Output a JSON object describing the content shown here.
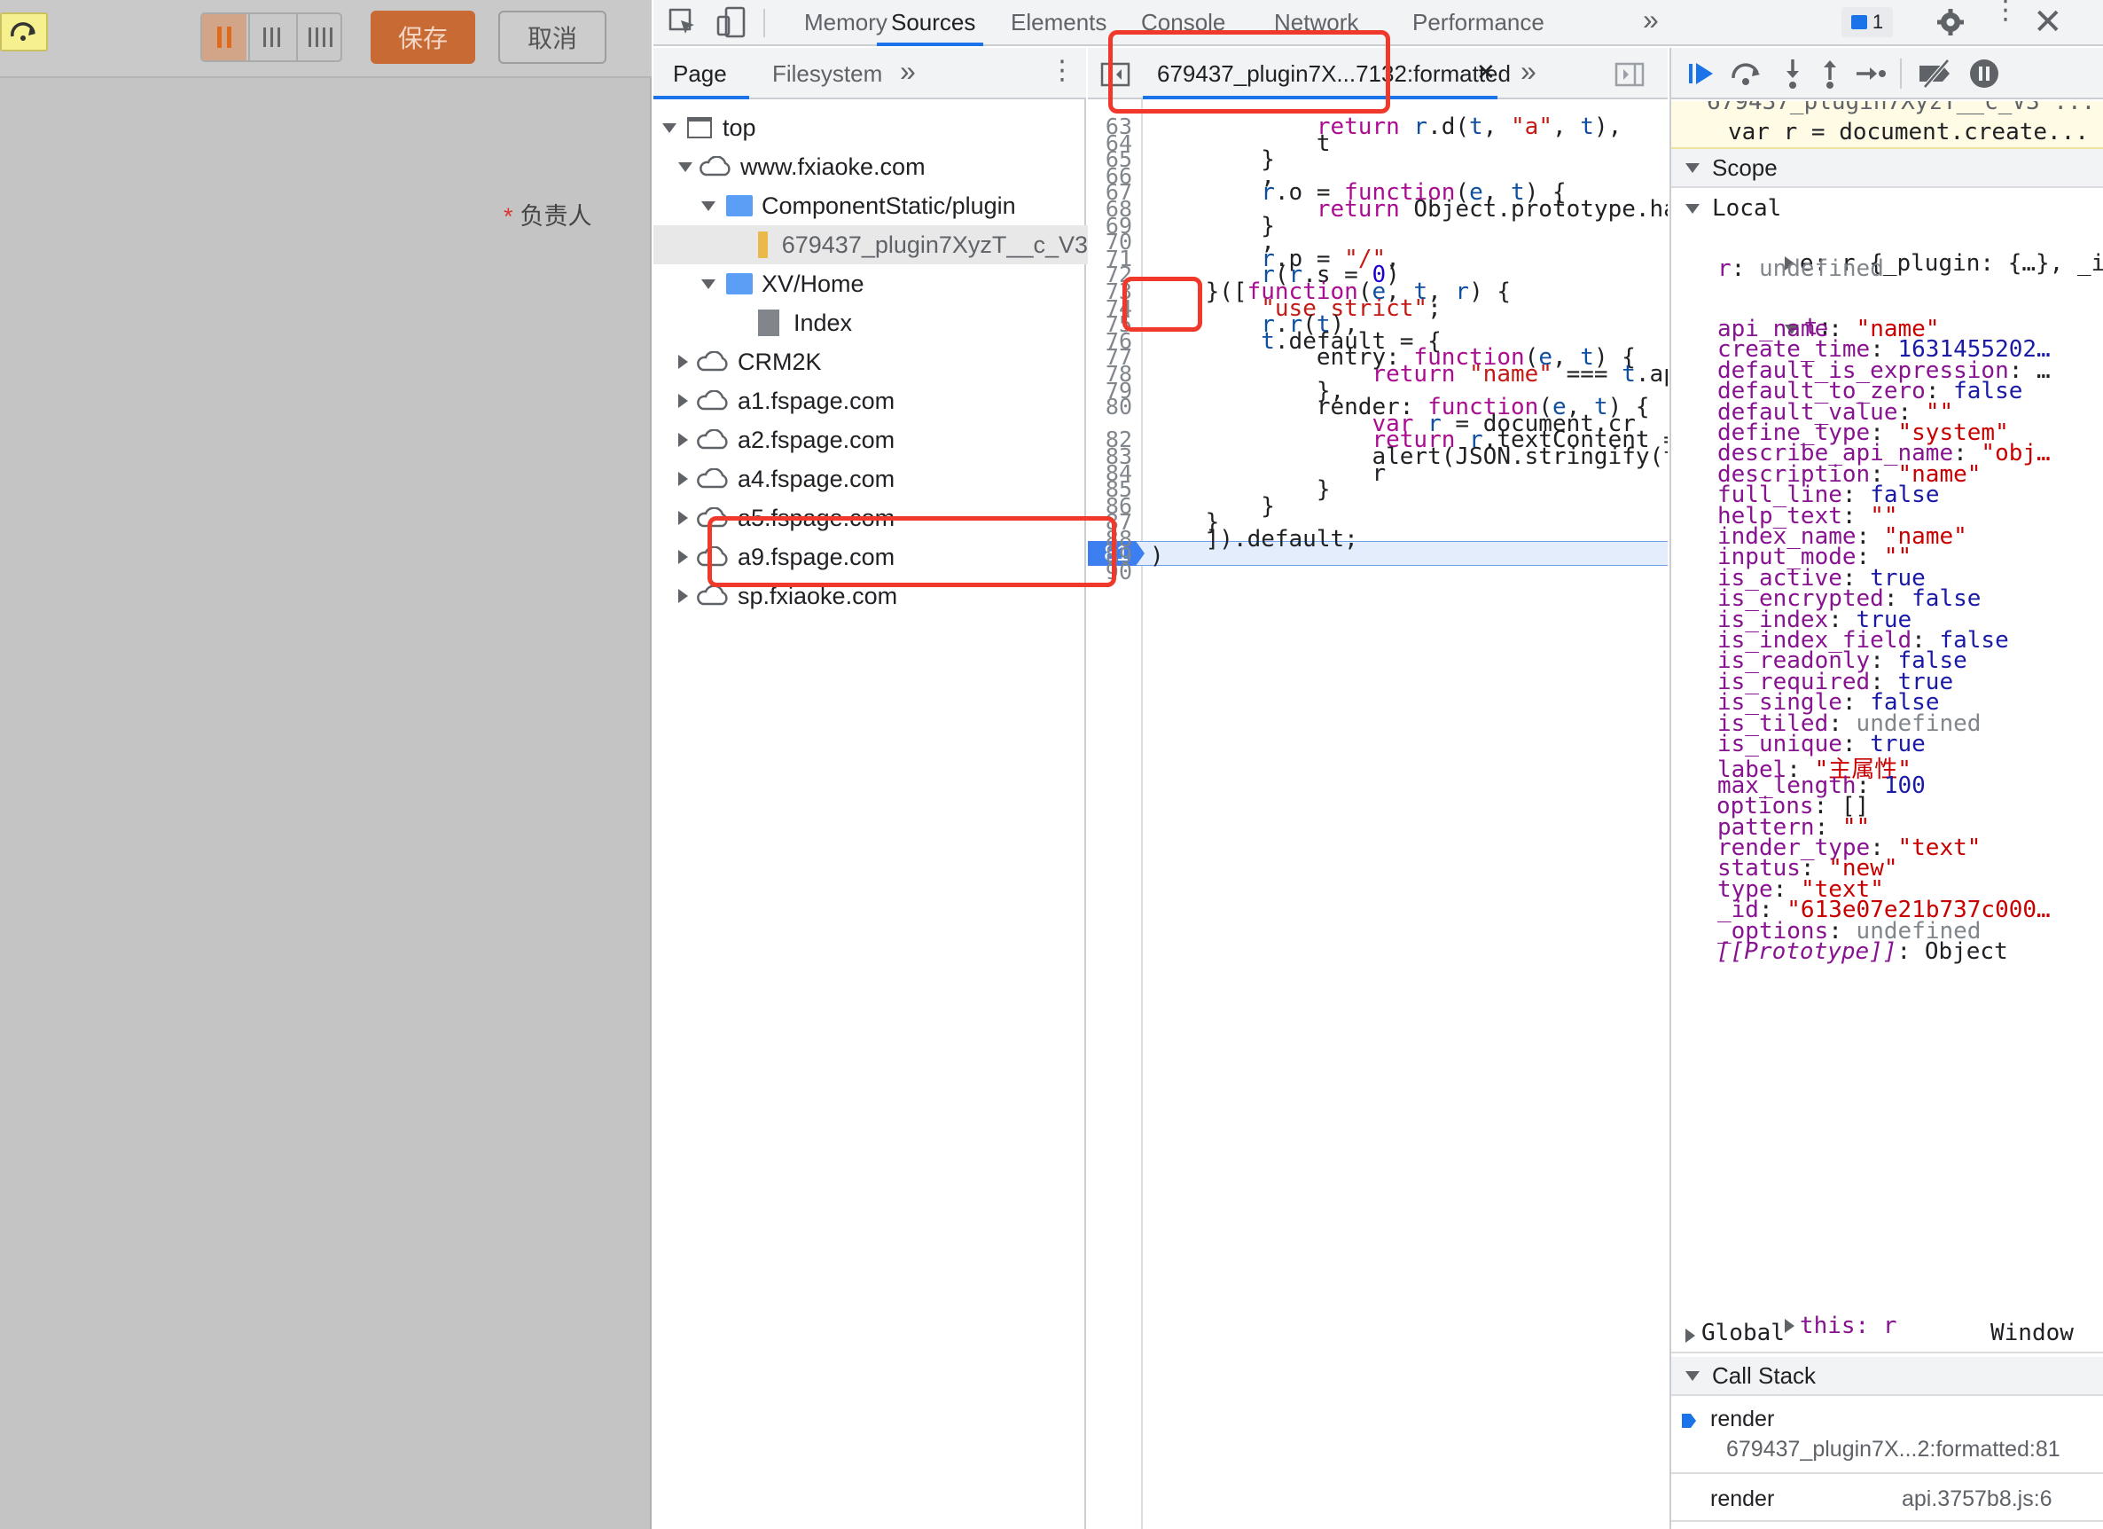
{
  "app": {
    "save_label": "保存",
    "cancel_label": "取消",
    "field_label": "负责人",
    "required_mark": "*"
  },
  "devtools": {
    "main_tabs": [
      "Memory",
      "Sources",
      "Elements",
      "Console",
      "Network",
      "Performance"
    ],
    "active_main_tab": "Sources",
    "message_count": "1",
    "navigator_tabs": [
      "Page",
      "Filesystem"
    ],
    "tree": [
      {
        "label": "top"
      },
      {
        "label": "www.fxiaoke.com"
      },
      {
        "label": "ComponentStatic/plugin"
      },
      {
        "label": "679437_plugin7XyzT__c_V3"
      },
      {
        "label": "XV/Home"
      },
      {
        "label": "Index"
      },
      {
        "label": "CRM2K"
      },
      {
        "label": "a1.fspage.com"
      },
      {
        "label": "a2.fspage.com"
      },
      {
        "label": "a4.fspage.com"
      },
      {
        "label": "a5.fspage.com"
      },
      {
        "label": "a9.fspage.com"
      },
      {
        "label": "sp.fxiaoke.com"
      }
    ],
    "editor_tab": "679437_plugin7X...7132:formatted",
    "breakpoint_line": "81",
    "code_lines": [
      {
        "n": "63",
        "t": "            return r.d(t, \"a\", t),"
      },
      {
        "n": "64",
        "t": "            t"
      },
      {
        "n": "65",
        "t": "        }"
      },
      {
        "n": "66",
        "t": "        ,"
      },
      {
        "n": "67",
        "t": "        r.o = function(e, t) {"
      },
      {
        "n": "68",
        "t": "            return Object.prototype.ha"
      },
      {
        "n": "69",
        "t": "        }"
      },
      {
        "n": "70",
        "t": "        ,"
      },
      {
        "n": "71",
        "t": "        r.p = \"/\","
      },
      {
        "n": "72",
        "t": "        r(r.s = 0)"
      },
      {
        "n": "73",
        "t": "    }([function(e, t, r) {"
      },
      {
        "n": "74",
        "t": "        \"use strict\";"
      },
      {
        "n": "75",
        "t": "        r.r(t),"
      },
      {
        "n": "76",
        "t": "        t.default = {"
      },
      {
        "n": "77",
        "t": "            entry: function(e, t) {"
      },
      {
        "n": "78",
        "t": "                return \"name\" === t.ap"
      },
      {
        "n": "79",
        "t": "            },"
      },
      {
        "n": "80",
        "t": "            render: function(e, t) {"
      },
      {
        "n": "81",
        "t": "                var r = document.cr"
      },
      {
        "n": "82",
        "t": "                return r.textContent ="
      },
      {
        "n": "83",
        "t": "                alert(JSON.stringify(t"
      },
      {
        "n": "84",
        "t": "                r"
      },
      {
        "n": "85",
        "t": "            }"
      },
      {
        "n": "86",
        "t": "        }"
      },
      {
        "n": "87",
        "t": "    }"
      },
      {
        "n": "88",
        "t": "    ]).default;"
      },
      {
        "n": "89",
        "t": ")"
      },
      {
        "n": "90",
        "t": ""
      }
    ],
    "paused_source_top": "679437_plugin7XyzT__c_V3 ...",
    "paused_source": "var r = document.create...",
    "scope_title": "Scope",
    "local_title": "Local",
    "local_e": "e: r {_plugin: {…}, _inst…",
    "local_r_key": "r",
    "local_r_val": "undefined",
    "local_t_key": "t",
    "props": [
      {
        "k": "api_name",
        "v": "\"name\"",
        "c": "s"
      },
      {
        "k": "create_time",
        "v": "1631455202…",
        "c": "n"
      },
      {
        "k": "default_is_expression",
        "v": "…",
        "c": "pl"
      },
      {
        "k": "default_to_zero",
        "v": "false",
        "c": "b"
      },
      {
        "k": "default_value",
        "v": "\"\"",
        "c": "s"
      },
      {
        "k": "define_type",
        "v": "\"system\"",
        "c": "s"
      },
      {
        "k": "describe_api_name",
        "v": "\"obj…",
        "c": "s"
      },
      {
        "k": "description",
        "v": "\"name\"",
        "c": "s"
      },
      {
        "k": "full_line",
        "v": "false",
        "c": "b"
      },
      {
        "k": "help_text",
        "v": "\"\"",
        "c": "s"
      },
      {
        "k": "index_name",
        "v": "\"name\"",
        "c": "s"
      },
      {
        "k": "input_mode",
        "v": "\"\"",
        "c": "s"
      },
      {
        "k": "is_active",
        "v": "true",
        "c": "b"
      },
      {
        "k": "is_encrypted",
        "v": "false",
        "c": "b"
      },
      {
        "k": "is_index",
        "v": "true",
        "c": "b"
      },
      {
        "k": "is_index_field",
        "v": "false",
        "c": "b"
      },
      {
        "k": "is_readonly",
        "v": "false",
        "c": "b"
      },
      {
        "k": "is_required",
        "v": "true",
        "c": "b"
      },
      {
        "k": "is_single",
        "v": "false",
        "c": "b"
      },
      {
        "k": "is_tiled",
        "v": "undefined",
        "c": "u"
      },
      {
        "k": "is_unique",
        "v": "true",
        "c": "b"
      },
      {
        "k": "label",
        "v": "\"主属性\"",
        "c": "s"
      },
      {
        "k": "max_length",
        "v": "100",
        "c": "n"
      },
      {
        "k": "options",
        "v": "[]",
        "c": "pl"
      },
      {
        "k": "pattern",
        "v": "\"\"",
        "c": "s"
      },
      {
        "k": "render_type",
        "v": "\"text\"",
        "c": "s"
      },
      {
        "k": "status",
        "v": "\"new\"",
        "c": "s"
      },
      {
        "k": "type",
        "v": "\"text\"",
        "c": "s"
      },
      {
        "k": "_id",
        "v": "\"613e07e21b737c000…",
        "c": "s"
      },
      {
        "k": "_options",
        "v": "undefined",
        "c": "u"
      },
      {
        "k": "[[Prototype]]",
        "v": "Object",
        "c": "pl"
      }
    ],
    "this_row": "this: r",
    "global_label": "Global",
    "global_value": "Window",
    "callstack_title": "Call Stack",
    "stack": [
      {
        "fn": "render",
        "loc": "679437_plugin7X...2:formatted:81"
      },
      {
        "fn": "render",
        "loc": "api.3757b8.js:6"
      }
    ]
  }
}
